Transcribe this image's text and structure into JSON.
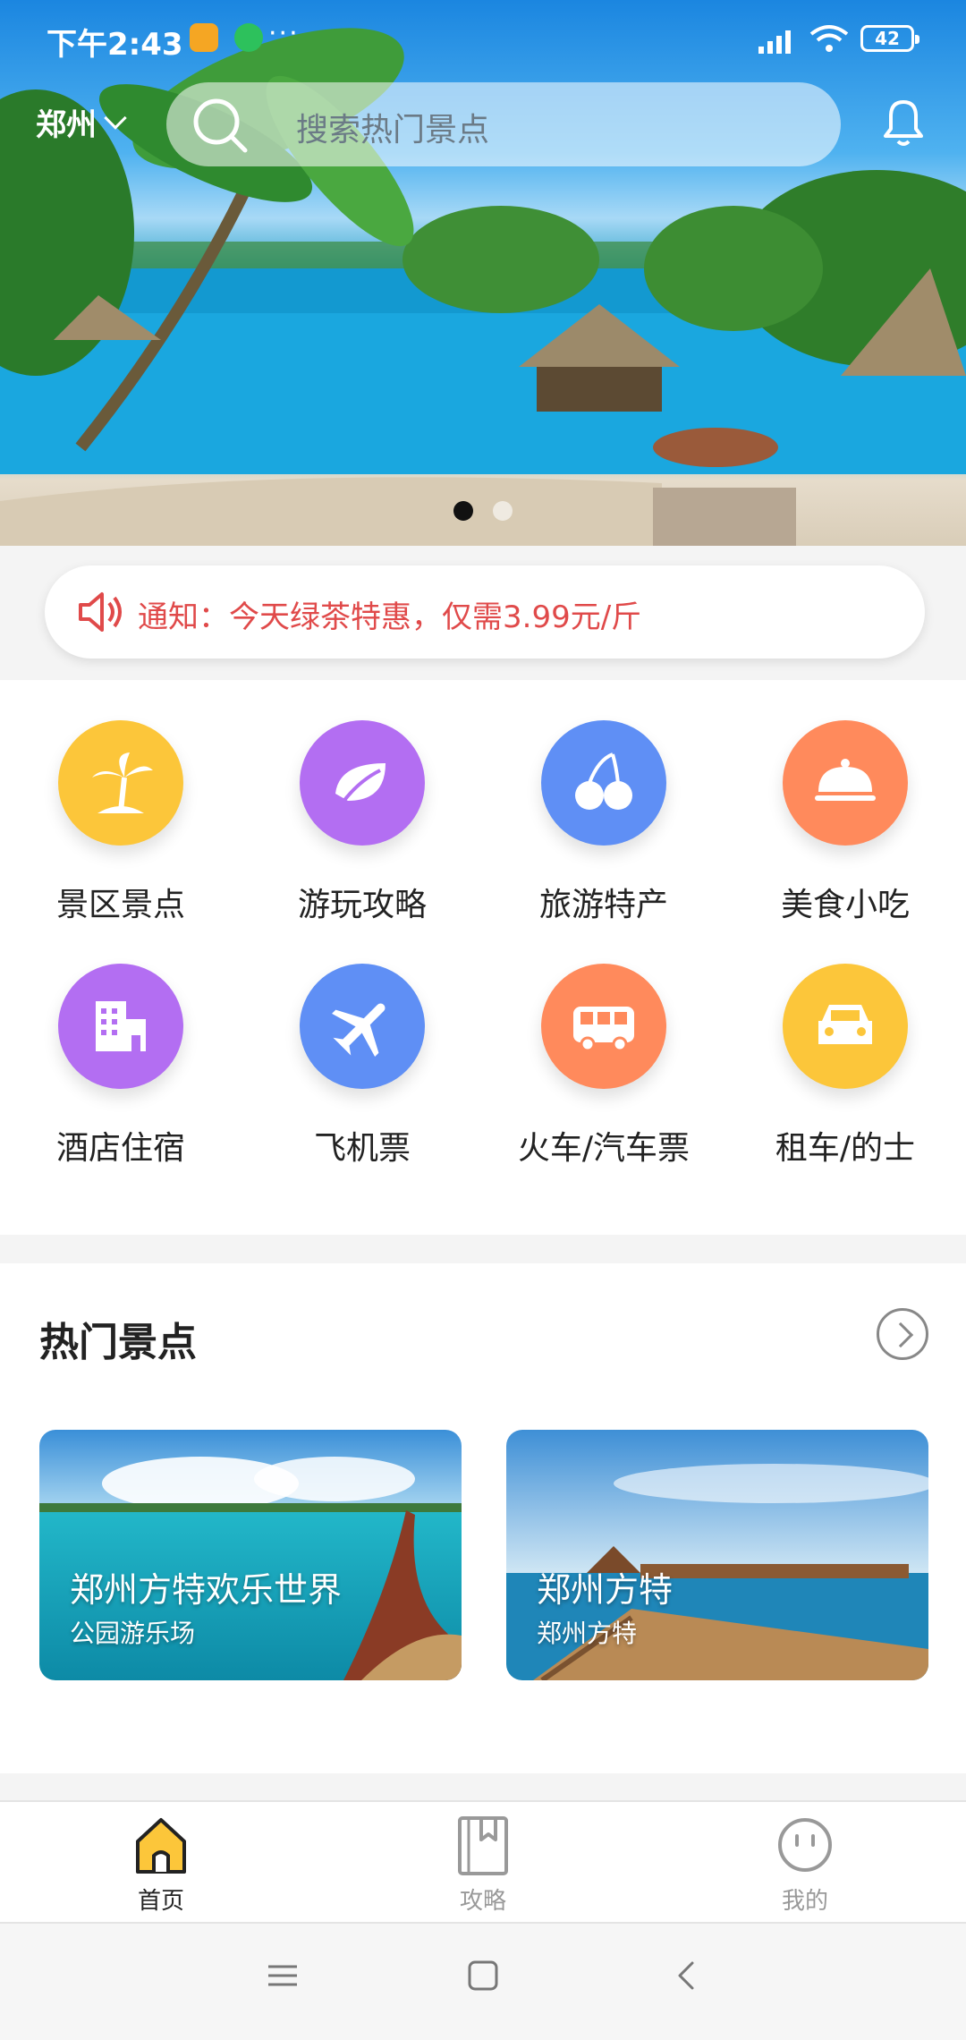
{
  "status_bar": {
    "time": "下午2:43",
    "battery": "42"
  },
  "header": {
    "city": "郑州",
    "search_placeholder": "搜索热门景点"
  },
  "banner": {
    "pages": 2,
    "active_page": 1
  },
  "notice": {
    "text": "通知：今天绿茶特惠，仅需3.99元/斤"
  },
  "categories": [
    {
      "label": "景区景点",
      "icon": "palm-tree-icon",
      "color": "#fcc63a"
    },
    {
      "label": "游玩攻略",
      "icon": "leaf-icon",
      "color": "#b36ef2"
    },
    {
      "label": "旅游特产",
      "icon": "cherry-icon",
      "color": "#5f8ff5"
    },
    {
      "label": "美食小吃",
      "icon": "food-cloche-icon",
      "color": "#ff8a5c"
    },
    {
      "label": "酒店住宿",
      "icon": "hotel-building-icon",
      "color": "#b36ef2"
    },
    {
      "label": "飞机票",
      "icon": "airplane-icon",
      "color": "#5f8ff5"
    },
    {
      "label": "火车/汽车票",
      "icon": "bus-icon",
      "color": "#ff8a5c"
    },
    {
      "label": "租车/的士",
      "icon": "car-icon",
      "color": "#fcc63a"
    }
  ],
  "hot_spots": {
    "title": "热门景点",
    "items": [
      {
        "title": "郑州方特欢乐世界",
        "subtitle": "公园游乐场"
      },
      {
        "title": "郑州方特",
        "subtitle": "郑州方特"
      }
    ]
  },
  "tabbar": {
    "items": [
      {
        "label": "首页",
        "icon": "home-icon",
        "active": true
      },
      {
        "label": "攻略",
        "icon": "bookmark-book-icon",
        "active": false
      },
      {
        "label": "我的",
        "icon": "profile-face-icon",
        "active": false
      }
    ]
  }
}
